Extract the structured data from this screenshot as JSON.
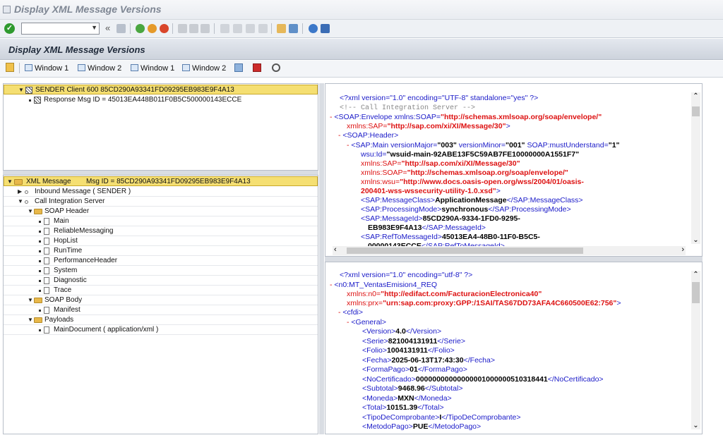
{
  "window": {
    "title": "Display XML Message Versions"
  },
  "toolbar": {
    "command_placeholder": "",
    "back_symbol": "«"
  },
  "screen": {
    "title": "Display XML Message Versions"
  },
  "app_toolbar": {
    "buttons": [
      {
        "label": "Window 1"
      },
      {
        "label": "Window 2"
      },
      {
        "label": "Window 1"
      },
      {
        "label": "Window 2"
      }
    ]
  },
  "top_tree": {
    "root": "SENDER Client 600 85CD290A93341FD09295EB983E9F4A13",
    "child": "Response Msg ID = 45013EA448B011F0B5C500000143ECCE"
  },
  "msg_tree": {
    "root_label": "XML Message",
    "root_id": "Msg ID = 85CD290A93341FD09295EB983E9F4A13",
    "inbound": "Inbound Message ( SENDER )",
    "call": "Call Integration Server",
    "soap_header": "SOAP Header",
    "header_items": [
      "Main",
      "ReliableMessaging",
      "HopList",
      "RunTime",
      "PerformanceHeader",
      "System",
      "Diagnostic",
      "Trace"
    ],
    "soap_body": "SOAP Body",
    "manifest": "Manifest",
    "payloads": "Payloads",
    "main_document": "MainDocument ( application/xml )"
  },
  "xml1": {
    "l1": "<?xml version=\"1.0\" encoding=\"UTF-8\" standalone=\"yes\" ?>",
    "l2": "<!--  Call Integration Server   -->",
    "l3a": "<SOAP:Envelope xmlns:SOAP=",
    "l3b": "\"http://schemas.xmlsoap.org/soap/envelope/\"",
    "l4a": "xmlns:SAP=",
    "l4b": "\"http://sap.com/xi/XI/Message/30\"",
    "l4c": ">",
    "l5": "<SOAP:Header>",
    "l6a": "<SAP:Main versionMajor=",
    "l6b": "\"003\"",
    "l6c": " versionMinor=",
    "l6d": "\"001\"",
    "l6e": " SOAP:mustUnderstand=",
    "l6f": "\"1\"",
    "l7a": "wsu:Id=",
    "l7b": "\"wsuid-main-92ABE13F5C59AB7FE10000000A1551F7\"",
    "l8a": "xmlns:SAP=",
    "l8b": "\"http://sap.com/xi/XI/Message/30\"",
    "l9a": "xmlns:SOAP=",
    "l9b": "\"http://schemas.xmlsoap.org/soap/envelope/\"",
    "l10a": "xmlns:wsu=",
    "l10b": "\"http://www.docs.oasis-open.org/wss/2004/01/oasis-",
    "l11a": "200401-wss-wssecurity-utility-1.0.xsd\"",
    "l11b": ">",
    "l12a": "<SAP:MessageClass>",
    "l12b": "ApplicationMessage",
    "l12c": "</SAP:MessageClass>",
    "l13a": "<SAP:ProcessingMode>",
    "l13b": "synchronous",
    "l13c": "</SAP:ProcessingMode>",
    "l14a": "<SAP:MessageId>",
    "l14b": "85CD290A-9334-1FD0-9295-",
    "l15a": "EB983E9F4A13",
    "l15b": "</SAP:MessageId>",
    "l16a": "<SAP:RefToMessageId>",
    "l16b": "45013EA4-48B0-11F0-B5C5-",
    "l17a": "00000143ECCE",
    "l17b": "</SAP:RefToMessageId>"
  },
  "xml2": {
    "l1": "<?xml version=\"1.0\" encoding=\"utf-8\" ?>",
    "l2": "<n0:MT_VentasEmision4_REQ",
    "l3a": "xmlns:n0=",
    "l3b": "\"http://edifact.com/FacturacionElectronica40\"",
    "l4a": "xmlns:prx=",
    "l4b": "\"urn:sap.com:proxy:GPP:/1SAI/TAS67DD73AFA4C660500E62:756\"",
    "l4c": ">",
    "l5": "<cfdi>",
    "l6": "<General>",
    "fields": [
      {
        "tag": "Version",
        "value": "4.0"
      },
      {
        "tag": "Serie",
        "value": "821004131911"
      },
      {
        "tag": "Folio",
        "value": "1004131911"
      },
      {
        "tag": "Fecha",
        "value": "2025-06-13T17:43:30"
      },
      {
        "tag": "FormaPago",
        "value": "01"
      },
      {
        "tag": "NoCertificado",
        "value": "00000000000000001000000510318441"
      },
      {
        "tag": "Subtotal",
        "value": "9468.96"
      },
      {
        "tag": "Moneda",
        "value": "MXN"
      },
      {
        "tag": "Total",
        "value": "10151.39"
      },
      {
        "tag": "TipoDeComprobante",
        "value": "I"
      },
      {
        "tag": "MetodoPago",
        "value": "PUE"
      }
    ]
  },
  "colors": {
    "tag": "#1a1ac8",
    "attr": "#d11111",
    "selected_row": "#f5df72"
  }
}
